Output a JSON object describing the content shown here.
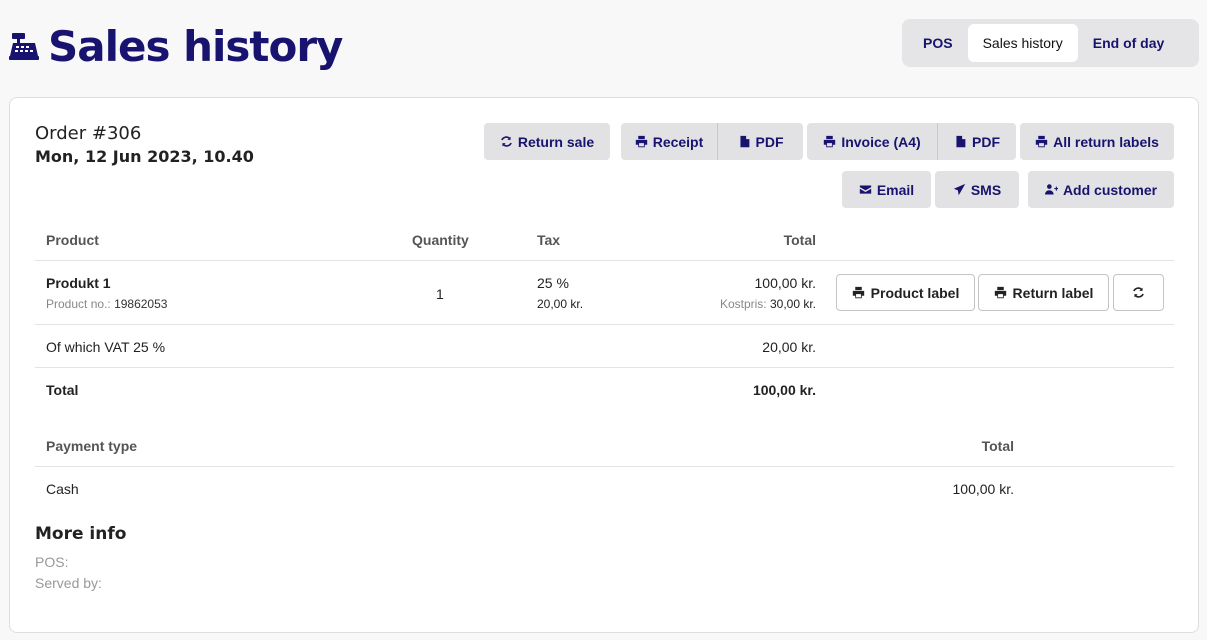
{
  "page": {
    "title": "Sales history",
    "icon": "cash-register-icon",
    "accent_color": "#17136e"
  },
  "nav_tabs": [
    {
      "label": "POS",
      "active": false
    },
    {
      "label": "Sales history",
      "active": true
    },
    {
      "label": "End of day",
      "active": false
    }
  ],
  "order": {
    "title": "Order #306",
    "date": "Mon, 12 Jun 2023, 10.40"
  },
  "actions": {
    "return_sale": "Return sale",
    "receipt": "Receipt",
    "receipt_pdf": "PDF",
    "invoice": "Invoice (A4)",
    "invoice_pdf": "PDF",
    "all_return_labels": "All return labels",
    "email": "Email",
    "sms": "SMS",
    "add_customer": "Add customer"
  },
  "products_table": {
    "headers": {
      "product": "Product",
      "quantity": "Quantity",
      "tax": "Tax",
      "total": "Total"
    },
    "rows": [
      {
        "name": "Produkt 1",
        "product_no_label": "Product no.:",
        "product_no": "19862053",
        "quantity": "1",
        "tax_rate": "25 %",
        "tax_amount": "20,00 kr.",
        "total": "100,00 kr.",
        "cost_label": "Kostpris:",
        "cost_value": "30,00 kr.",
        "product_label_btn": "Product label",
        "return_label_btn": "Return label"
      }
    ],
    "vat_label": "Of which VAT 25 %",
    "vat_value": "20,00 kr.",
    "total_label": "Total",
    "total_value": "100,00 kr."
  },
  "payments_table": {
    "headers": {
      "payment_type": "Payment type",
      "total": "Total"
    },
    "rows": [
      {
        "type": "Cash",
        "total": "100,00 kr."
      }
    ]
  },
  "more_info": {
    "title": "More info",
    "pos_label": "POS:",
    "served_by_label": "Served by:"
  }
}
